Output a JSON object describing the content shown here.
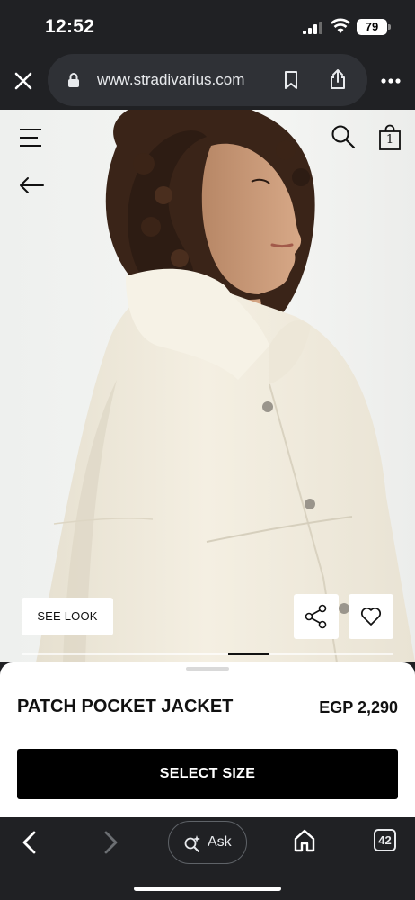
{
  "status_bar": {
    "time": "12:52",
    "battery": "79"
  },
  "browser": {
    "url": "www.stradivarius.com",
    "tab_count": "42",
    "ask_label": "Ask"
  },
  "store_header": {
    "bag_count": "1"
  },
  "hero": {
    "see_look_label": "SEE LOOK",
    "carousel_position": 0.6
  },
  "product": {
    "name": "PATCH POCKET JACKET",
    "price": "EGP 2,290",
    "cta_label": "SELECT SIZE"
  },
  "icons": [
    "close-icon",
    "lock-icon",
    "bookmark-icon",
    "share-icon",
    "more-icon",
    "menu-icon",
    "search-icon",
    "bag-icon",
    "arrow-left-icon",
    "heart-icon",
    "chevron-left-icon",
    "chevron-right-icon",
    "ask-sparkle-icon",
    "home-icon"
  ],
  "colors": {
    "chrome_bg": "#202124",
    "cta_bg": "#000000",
    "jacket": "#f2ede0"
  }
}
